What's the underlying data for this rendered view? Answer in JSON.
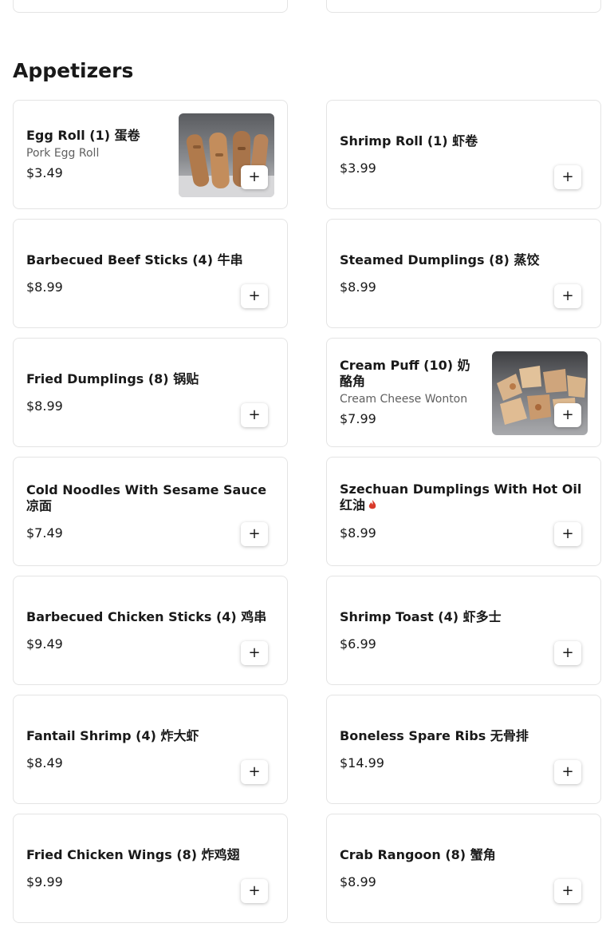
{
  "section": {
    "title": "Appetizers"
  },
  "items": [
    {
      "name": "Egg Roll (1) 蛋卷",
      "desc": "Pork Egg Roll",
      "price": "$3.49",
      "image": "egg-roll-photo"
    },
    {
      "name": "Shrimp Roll (1) 虾卷",
      "price": "$3.99"
    },
    {
      "name": "Barbecued Beef Sticks (4) 牛串",
      "price": "$8.99"
    },
    {
      "name": "Steamed Dumplings (8) 蒸饺",
      "price": "$8.99"
    },
    {
      "name": "Fried Dumplings (8) 锅贴",
      "price": "$8.99"
    },
    {
      "name": "Cream Puff (10) 奶酪角",
      "desc": "Cream Cheese Wonton",
      "price": "$7.99",
      "image": "cream-puff-photo"
    },
    {
      "name": "Cold Noodles With Sesame Sauce 凉面",
      "price": "$7.49"
    },
    {
      "name": "Szechuan Dumplings With Hot Oil 红油",
      "price": "$8.99",
      "spicy": true,
      "spicy_icon": "chili-pepper-icon"
    },
    {
      "name": "Barbecued Chicken Sticks (4) 鸡串",
      "price": "$9.49"
    },
    {
      "name": "Shrimp Toast (4) 虾多士",
      "price": "$6.99"
    },
    {
      "name": "Fantail Shrimp (4) 炸大虾",
      "price": "$8.49"
    },
    {
      "name": "Boneless Spare Ribs 无骨排",
      "price": "$14.99"
    },
    {
      "name": "Fried Chicken Wings (8) 炸鸡翅",
      "price": "$9.99"
    },
    {
      "name": "Crab Rangoon (8) 蟹角",
      "price": "$8.99"
    }
  ],
  "add_button": {
    "label": "+"
  },
  "colors": {
    "spicy": "#d93a2b",
    "border": "#e4e4e4",
    "text": "#191919",
    "muted": "#606060"
  }
}
